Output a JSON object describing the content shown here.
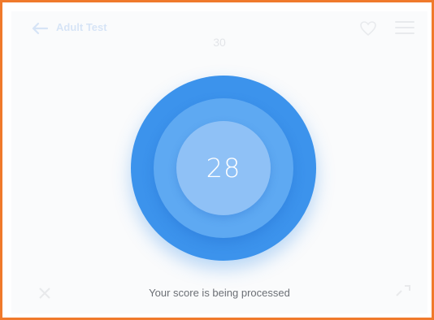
{
  "header": {
    "back_icon": "back-arrow-icon",
    "title": "Adult Test",
    "favorite_icon": "heart-icon",
    "menu_icon": "hamburger-menu-icon"
  },
  "question_counter": "30",
  "score": {
    "value": "28",
    "status": "Your score is being processed"
  },
  "colors": {
    "frame_border": "#F07A2C",
    "ring_outer": "#3c93ec",
    "ring_middle": "#5ea9f2",
    "ring_inner": "#8fc1f6",
    "accent": "#3b7fe0"
  },
  "footer": {
    "left_icon": "close-icon",
    "right_icon": "expand-icon"
  }
}
